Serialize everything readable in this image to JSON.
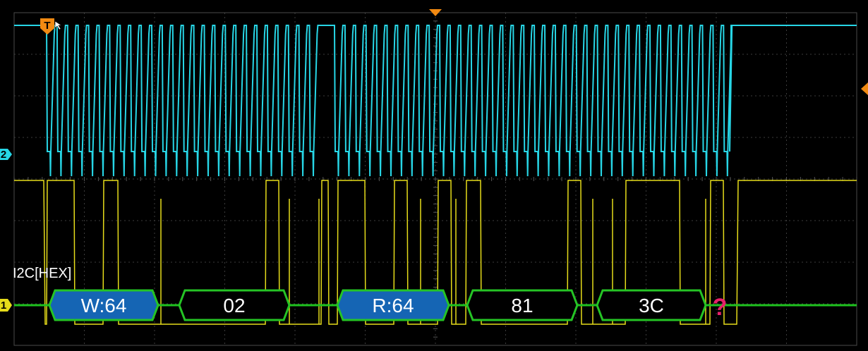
{
  "scope": {
    "top_label": "",
    "trigger_marker": "T",
    "channel2_marker": "2",
    "channel1_marker": "1",
    "decode_label": "I2C[HEX]",
    "error_symbol": "?"
  },
  "colors": {
    "clock": "#27d6e6",
    "data": "#e6dc1a",
    "bus": "#1ec21e",
    "grid": "#3b3b3b",
    "address_fill": "#1565b4",
    "data_fill": "#000000",
    "packet_border": "#25c425",
    "marker": "#f28a12",
    "error": "#e8206a"
  },
  "packets": [
    {
      "label": "W:64",
      "kind": "address"
    },
    {
      "label": "02",
      "kind": "data"
    },
    {
      "label": "R:64",
      "kind": "address"
    },
    {
      "label": "81",
      "kind": "data"
    },
    {
      "label": "3C",
      "kind": "data"
    }
  ]
}
